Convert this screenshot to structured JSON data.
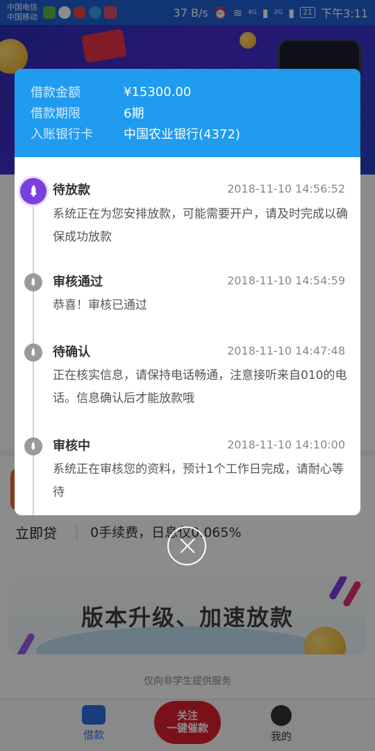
{
  "status_bar": {
    "carrier1": "中国电信",
    "carrier2": "中国移动",
    "speed": "37 B/s",
    "net1": "4G",
    "net2": "2G",
    "battery": "21",
    "time": "下午3:11"
  },
  "modal": {
    "amount_label": "借款金额",
    "amount_value": "¥15300.00",
    "term_label": "借款期限",
    "term_value": "6期",
    "bank_label": "入账银行卡",
    "bank_value": "中国农业银行(4372)",
    "steps": [
      {
        "title": "待放款",
        "time": "2018-11-10 14:56:52",
        "desc": "系统正在为您安排放款，可能需要开户，请及时完成以确保成功放款"
      },
      {
        "title": "审核通过",
        "time": "2018-11-10 14:54:59",
        "desc": "恭喜！审核已通过"
      },
      {
        "title": "待确认",
        "time": "2018-11-10 14:47:48",
        "desc": "正在核实信息，请保持电话畅通，注意接听来自010的电话。信息确认后才能放款哦"
      },
      {
        "title": "审核中",
        "time": "2018-11-10 14:10:00",
        "desc": "系统正在审核您的资料，预计1个工作日完成，请耐心等待"
      }
    ]
  },
  "background": {
    "loan_name": "立即贷",
    "loan_desc": "0手续费，日息仅0.065%",
    "promo": "版本升级、加速放款",
    "footnote": "仅向非学生提供服务"
  },
  "tabbar": {
    "loan": "借款",
    "follow_line1": "关注",
    "follow_line2": "一键催款",
    "me": "我的"
  },
  "colors": {
    "header_blue": "#1f9bf0",
    "active_node": "#7a3fe0",
    "follow_red": "#e0202c"
  },
  "icons": [
    "rocket-icon",
    "close-icon",
    "wallet-icon",
    "person-icon",
    "clock-icon",
    "wifi-icon",
    "alarm-icon"
  ]
}
